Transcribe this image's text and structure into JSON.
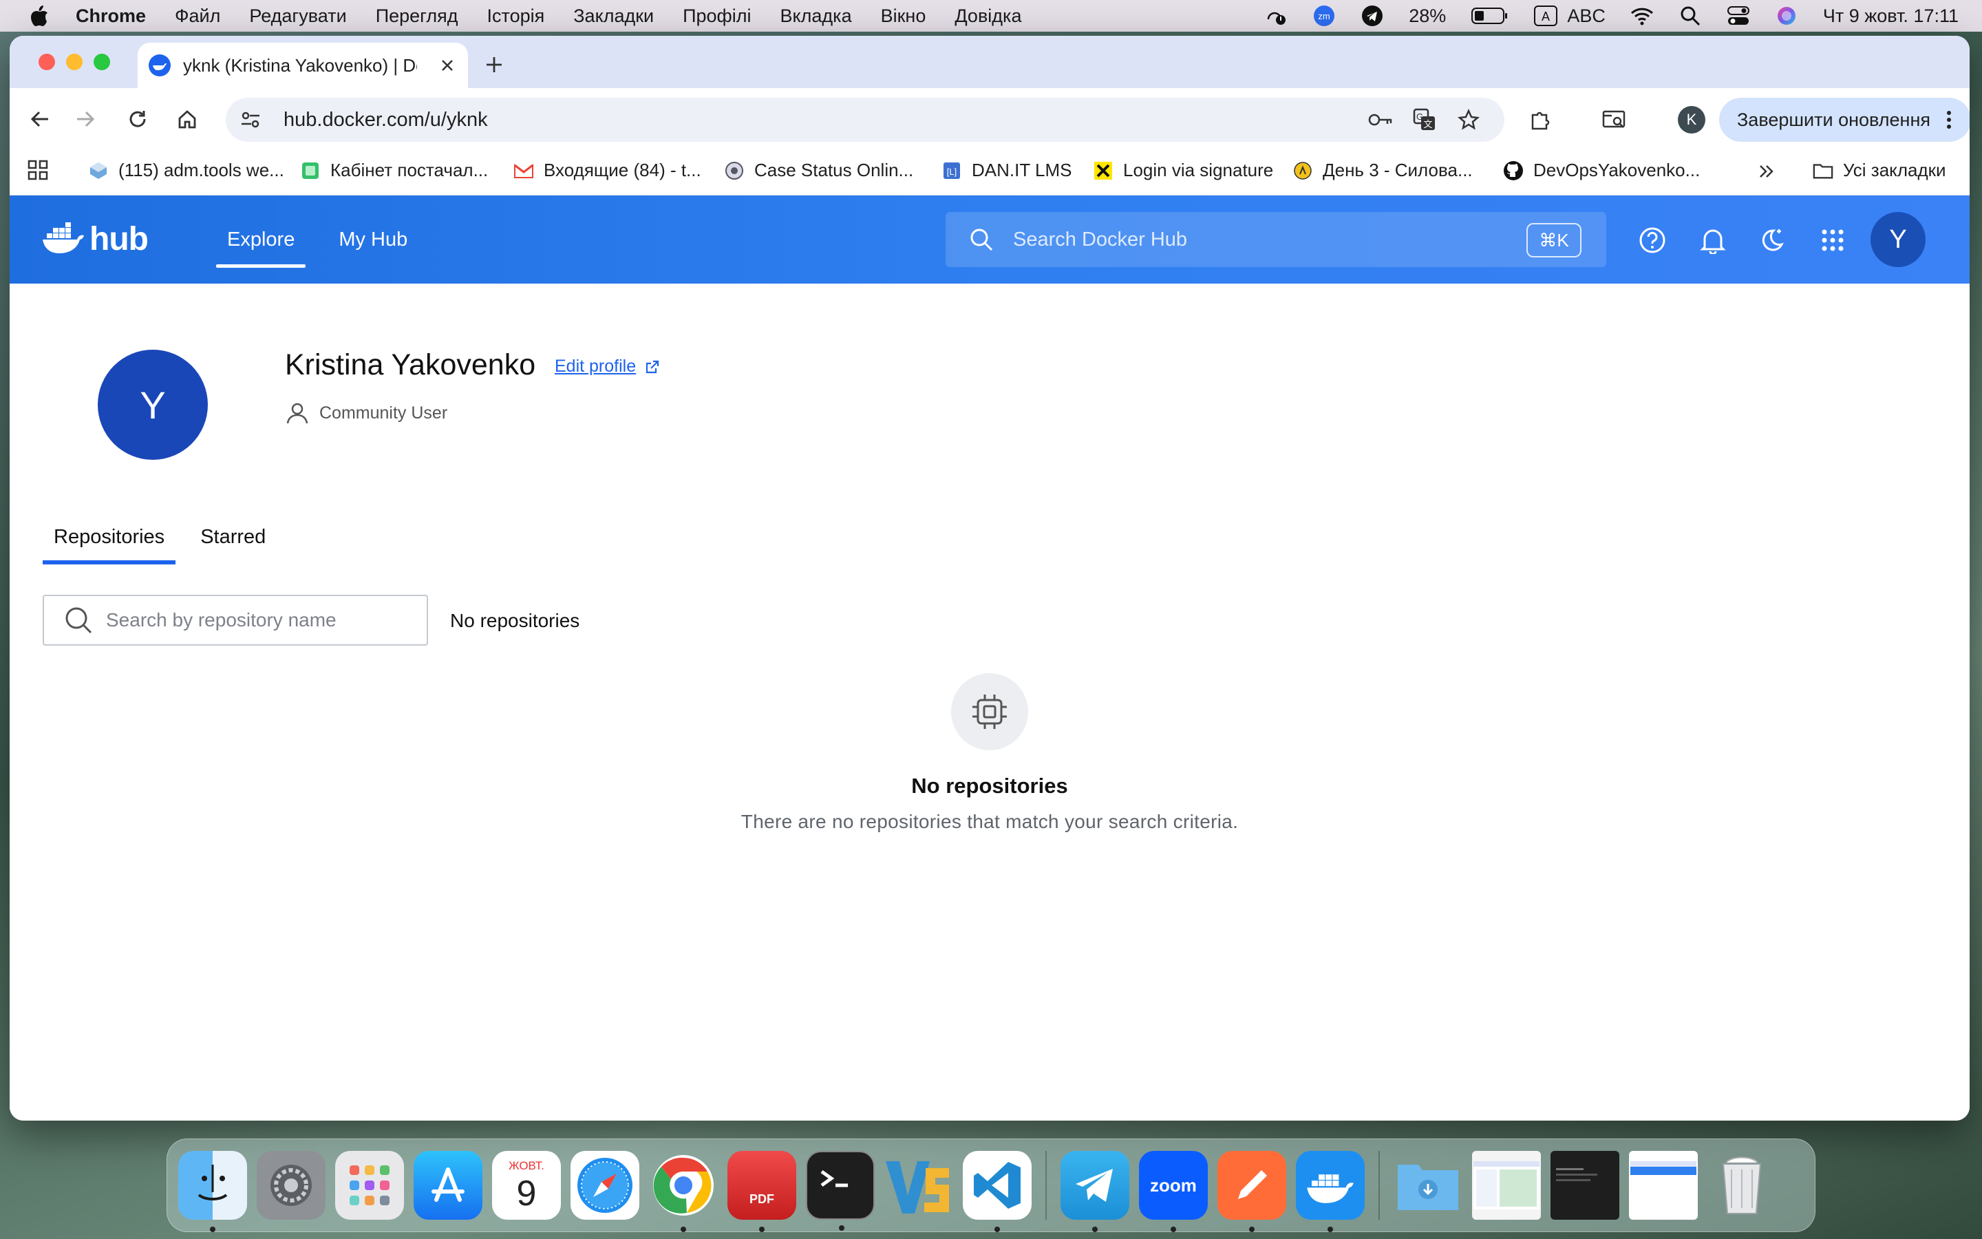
{
  "menubar": {
    "app_name": "Chrome",
    "items": [
      "Файл",
      "Редагувати",
      "Перегляд",
      "Історія",
      "Закладки",
      "Профілі",
      "Вкладка",
      "Вікно",
      "Довідка"
    ],
    "battery": "28%",
    "input_source": "ABC",
    "datetime": "Чт 9 жовт.  17:11"
  },
  "browser": {
    "tab_title": "yknk (Kristina Yakovenko) | Do",
    "url": "hub.docker.com/u/yknk",
    "profile_initial": "K",
    "update_button": "Завершити оновлення",
    "bookmarks": [
      "(115) adm.tools we...",
      "Кабінет постачал...",
      "Входящие (84) - t...",
      "Case Status Onlin...",
      "DAN.IT LMS",
      "Login via signature",
      "День 3 - Силова...",
      "DevOpsYakovenko..."
    ],
    "all_bookmarks": "Усі закладки"
  },
  "hub": {
    "logo_text": "hub",
    "nav": [
      "Explore",
      "My Hub"
    ],
    "search_placeholder": "Search Docker Hub",
    "search_shortcut": "⌘K",
    "avatar_initial": "Y"
  },
  "profile": {
    "avatar_initial": "Y",
    "name": "Kristina Yakovenko",
    "edit_link": "Edit profile",
    "role": "Community User"
  },
  "repos": {
    "tabs": [
      "Repositories",
      "Starred"
    ],
    "search_placeholder": "Search by repository name",
    "count_label": "No repositories",
    "empty_title": "No repositories",
    "empty_description": "There are no repositories that match your search criteria."
  },
  "dock": {
    "calendar_month": "ЖОВТ.",
    "calendar_day": "9",
    "zoom_label": "zoom",
    "pdf_label": "PDF"
  }
}
